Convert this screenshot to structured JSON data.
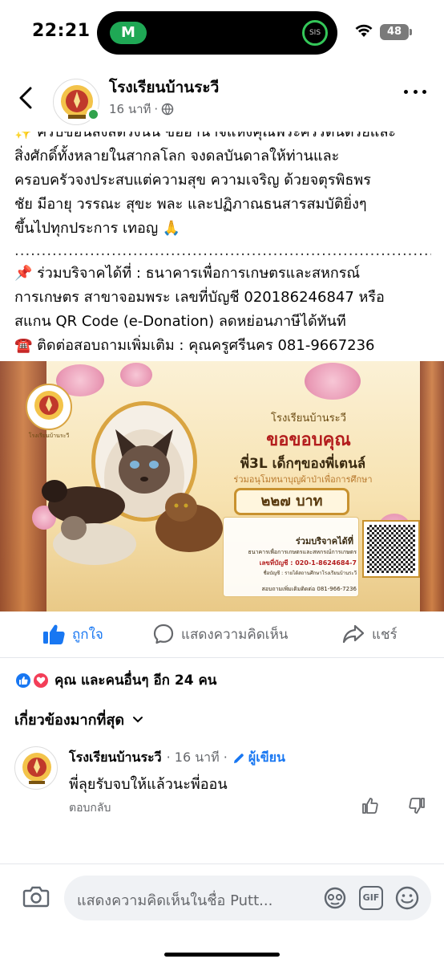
{
  "status_bar": {
    "time": "22:21",
    "island_app": "M",
    "island_ring_label": "SIS",
    "battery": "48"
  },
  "post": {
    "page_name": "โรงเรียนบ้านระวี",
    "time": "16 นาที",
    "visibility_icon": "globe-icon",
    "text_lines": [
      "✨ ครบขอนสังสตรงนั้น ขออานาจแห่งคุณพระศรีรัตนตรัยและ",
      "สิ่งศักดิ์ทั้งหลายในสากลโลก  จงดลบันดาลให้ท่านและ",
      "ครอบครัวจงประสบแต่ความสุข  ความเจริญ  ด้วยจตุรพิธพร",
      "ชัย มีอายุ  วรรณะ  สุขะ  พละ  และปฏิภาณธนสารสมบัติยิ่งๆ",
      "ขึ้นไปทุกประการ  เทอญ 🙏"
    ],
    "separator": "................................................................................................",
    "donation_lines": [
      "📌 ร่วมบริจาคได้ที่ : ธนาคารเพื่อการเกษตรและสหกรณ์",
      "การเกษตร  สาขาจอมพระ เลขที่บัญชี 020186246847 หรือ",
      "สแกน QR Code (e-Donation) ลดหย่อนภาษีได้ทันที",
      "☎️ ติดต่อสอบถามเพิ่มเติม : คุณครูศรีนคร 081-9667236"
    ]
  },
  "banner": {
    "logo_caption": "โรงเรียนบ้านระวี",
    "school_name": "โรงเรียนบ้านระวี",
    "thanks": "ขอขอบคุณ",
    "donor": "พี่3L เด็กๆของพี่เตนล์",
    "donate_sub": "ร่วมอนุโมทนาบุญผ้าป่าเพื่อการศึกษา",
    "amount": "๒๒๗ บาท",
    "info_title": "ร่วมบริจาคได้ที่",
    "info_bank": "ธนาคารเพื่อการเกษตรและสหกรณ์การเกษตร",
    "info_account": "เลขที่บัญชี : 020-1-8624684-7",
    "info_name": "ชื่อบัญชี : รายได้สถานศึกษาโรงเรียนบ้านระวี",
    "info_contact": "สอบถามเพิ่มเติมติดต่อ 081-966-7236"
  },
  "actions": {
    "like": "ถูกใจ",
    "comment": "แสดงความคิดเห็น",
    "share": "แชร์"
  },
  "reactions": {
    "summary": "คุณ และคนอื่นๆ อีก 24 คน"
  },
  "comments": {
    "sort_label": "เกี่ยวข้องมากที่สุด",
    "items": [
      {
        "name": "โรงเรียนบ้านระวี",
        "time": "· 16 นาที ·",
        "badge": "ผู้เขียน",
        "text": "พี่ลุยรับจบให้แล้วนะพี่ออน",
        "reply": "ตอบกลับ"
      }
    ]
  },
  "composer": {
    "placeholder": "แสดงความคิดเห็นในชื่อ Putt..."
  },
  "colors": {
    "facebook_blue": "#1877f2",
    "love_red": "#f33e58",
    "online_green": "#31a24c"
  }
}
